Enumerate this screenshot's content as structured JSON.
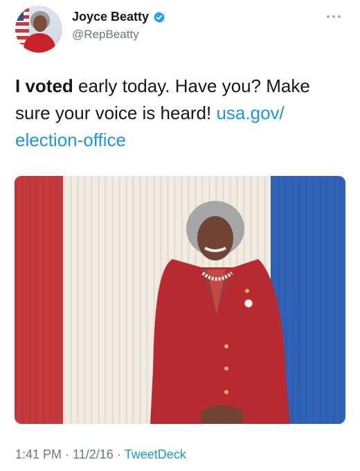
{
  "author": {
    "name": "Joyce Beatty",
    "handle": "@RepBeatty",
    "verified": true,
    "avatar_icon": "profile-photo"
  },
  "tweet": {
    "text_bold": "I voted",
    "text_plain": " early today. Have you? Make sure your voice is heard! ",
    "link_line1": "usa.gov/",
    "link_line2": "election-office"
  },
  "media": {
    "type": "photo",
    "backdrop_colors": [
      "#c63a3d",
      "#f1ebe2",
      "#2f63b8"
    ]
  },
  "footer": {
    "time": "1:41 PM",
    "date": "11/2/16",
    "separator": "·",
    "source": "TweetDeck"
  },
  "colors": {
    "link": "#1b95e0",
    "secondary": "#657786",
    "verified_badge": "#1da1f2"
  },
  "icons": [
    "verified-badge-icon",
    "more-options-icon"
  ]
}
